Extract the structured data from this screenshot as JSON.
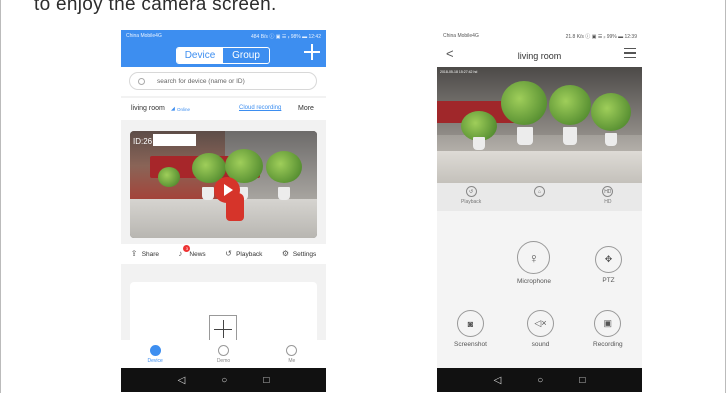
{
  "headline": "to enjoy the camera screen.",
  "phone1": {
    "status_left": "China Mobile4G",
    "status_right": "484 B/s ⓘ ▣ ☰ ᵢₗ 98% ▬ 12:42",
    "segment": {
      "device": "Device",
      "group": "Group"
    },
    "search_placeholder": "search for device (name or ID)",
    "device_row": {
      "name": "living room",
      "status": "Online",
      "cloud_recording": "Cloud recording",
      "more": "More"
    },
    "camera_id": "ID:26",
    "actions": {
      "share": "Share",
      "news": "News",
      "news_badge": "3",
      "playback": "Playback",
      "settings": "Settings"
    },
    "tabs": {
      "device": "Device",
      "demo": "Demo",
      "me": "Me"
    },
    "nav": {
      "back": "◁",
      "home": "○",
      "recent": "□"
    }
  },
  "phone2": {
    "status_left": "China Mobile4G",
    "status_right": "21.8 K/s ⓘ ▣ ☰ ᵢₗ 99% ▬ 12:39",
    "title": "living room",
    "video_osd": "2018-05-18 15:27:42 hd",
    "functions": {
      "playback": "Playback",
      "hd": "HD"
    },
    "controls": {
      "microphone": "Microphone",
      "ptz": "PTZ",
      "screenshot": "Screenshot",
      "sound": "sound",
      "recording": "Recording"
    },
    "nav": {
      "back": "◁",
      "home": "○",
      "recent": "□"
    }
  }
}
